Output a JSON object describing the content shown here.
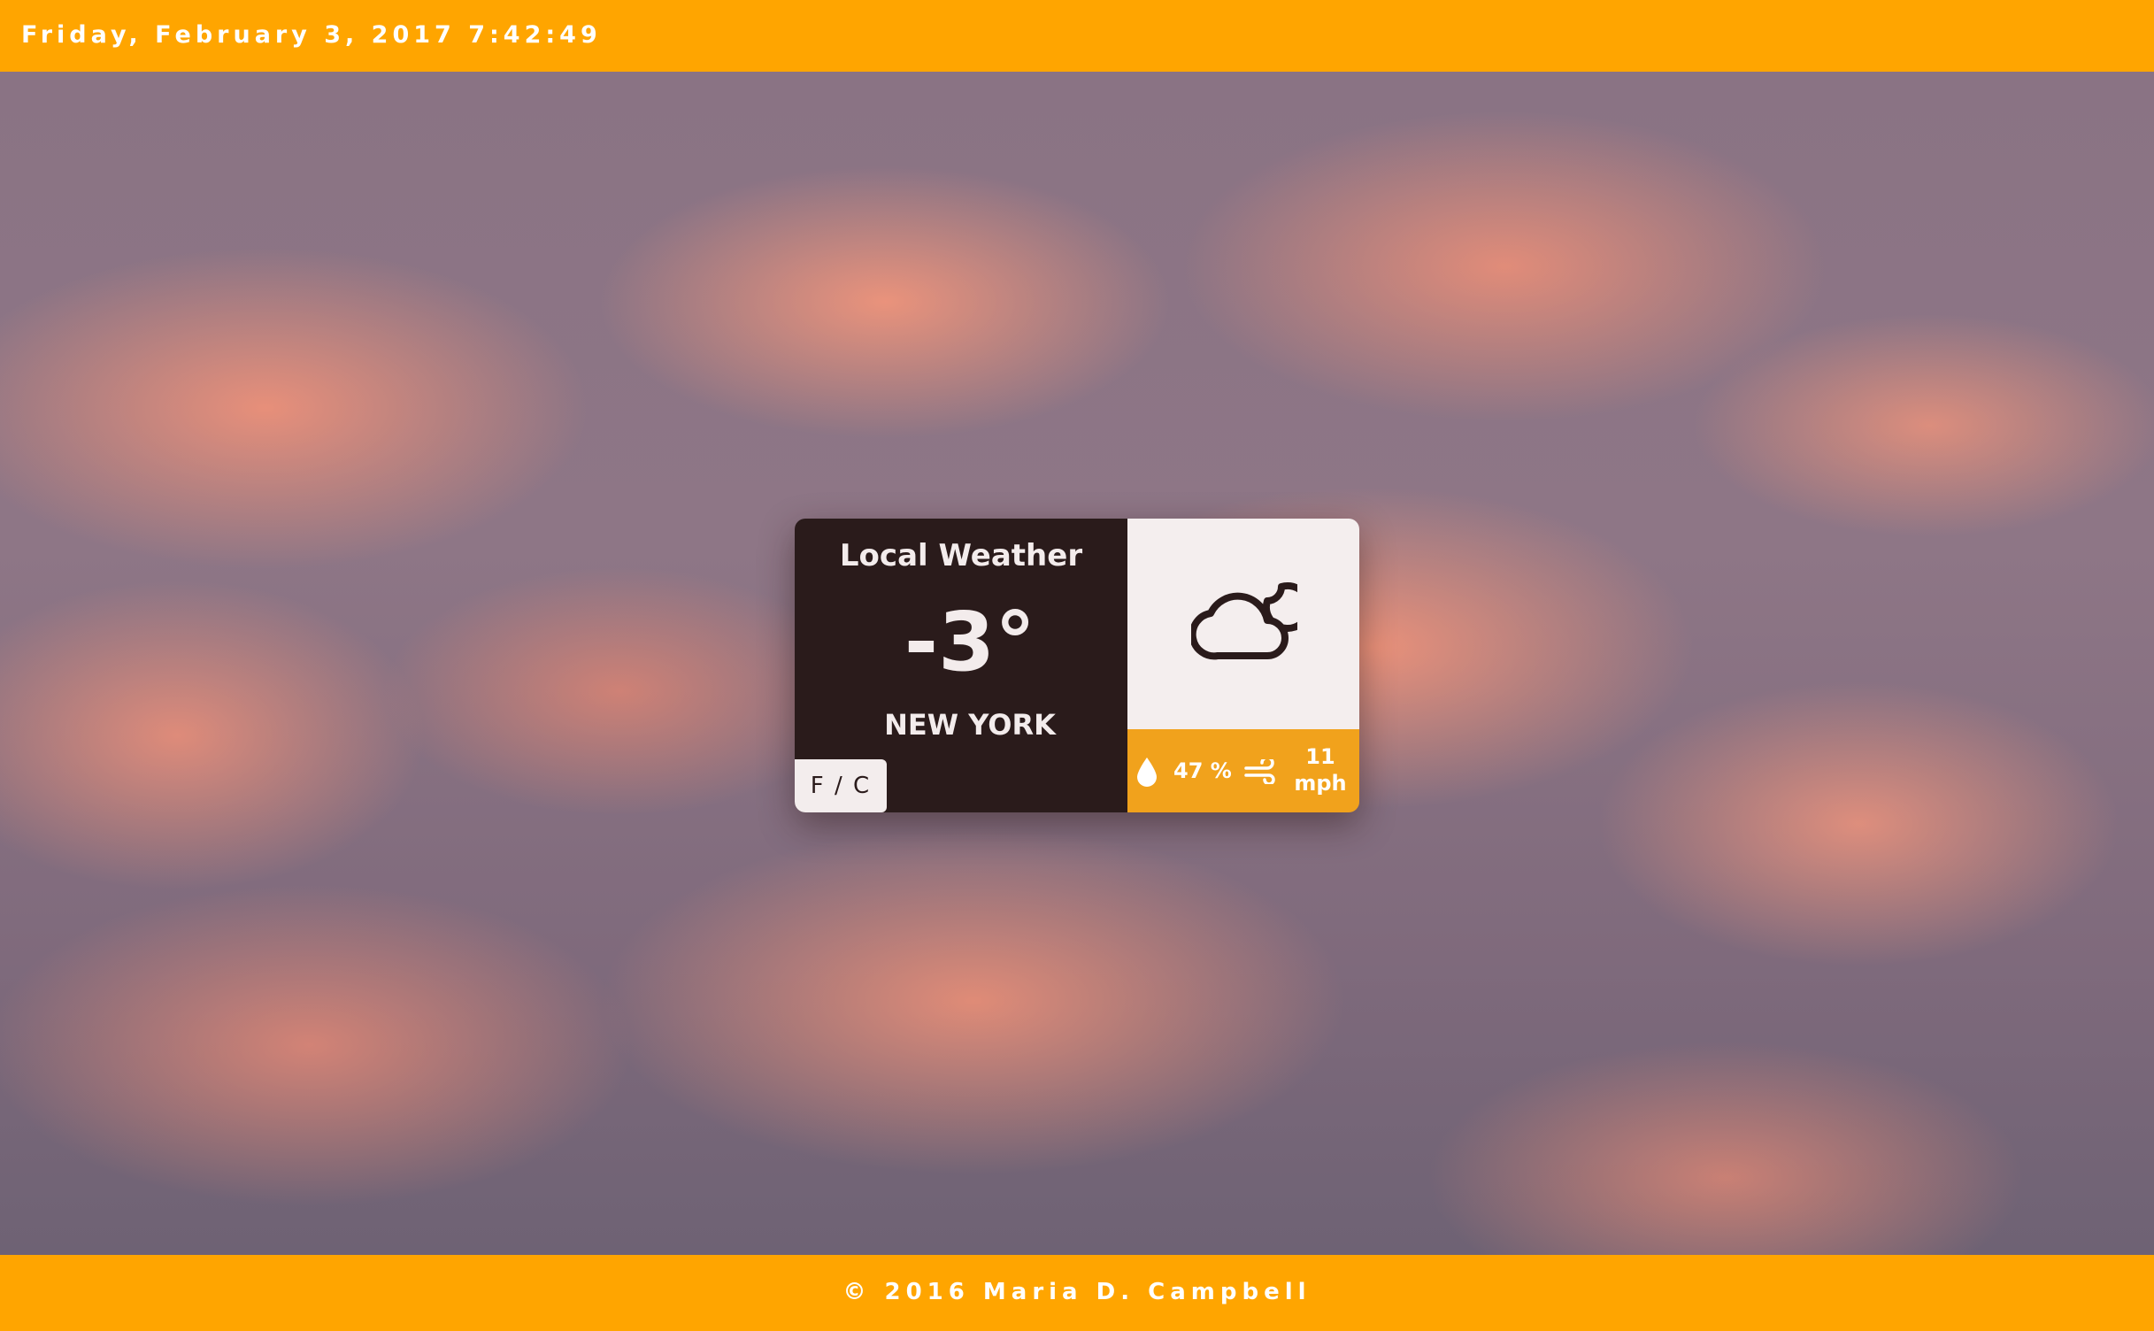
{
  "header": {
    "datetime": "Friday, February 3, 2017 7:42:49"
  },
  "weather_card": {
    "title": "Local Weather",
    "temperature": "-3°",
    "city": "NEW YORK",
    "unit_toggle_label": "F / C",
    "condition_icon": "partly-cloudy-night-icon",
    "humidity": "47 %",
    "wind_speed_value": "11",
    "wind_speed_unit": "mph"
  },
  "footer": {
    "copyright": "© 2016 Maria D. Campbell"
  },
  "colors": {
    "accent": "#FFA500",
    "stats_bar": "#F1A21C",
    "card_dark": "#2A1B1B",
    "card_light": "#F4EEEE"
  }
}
